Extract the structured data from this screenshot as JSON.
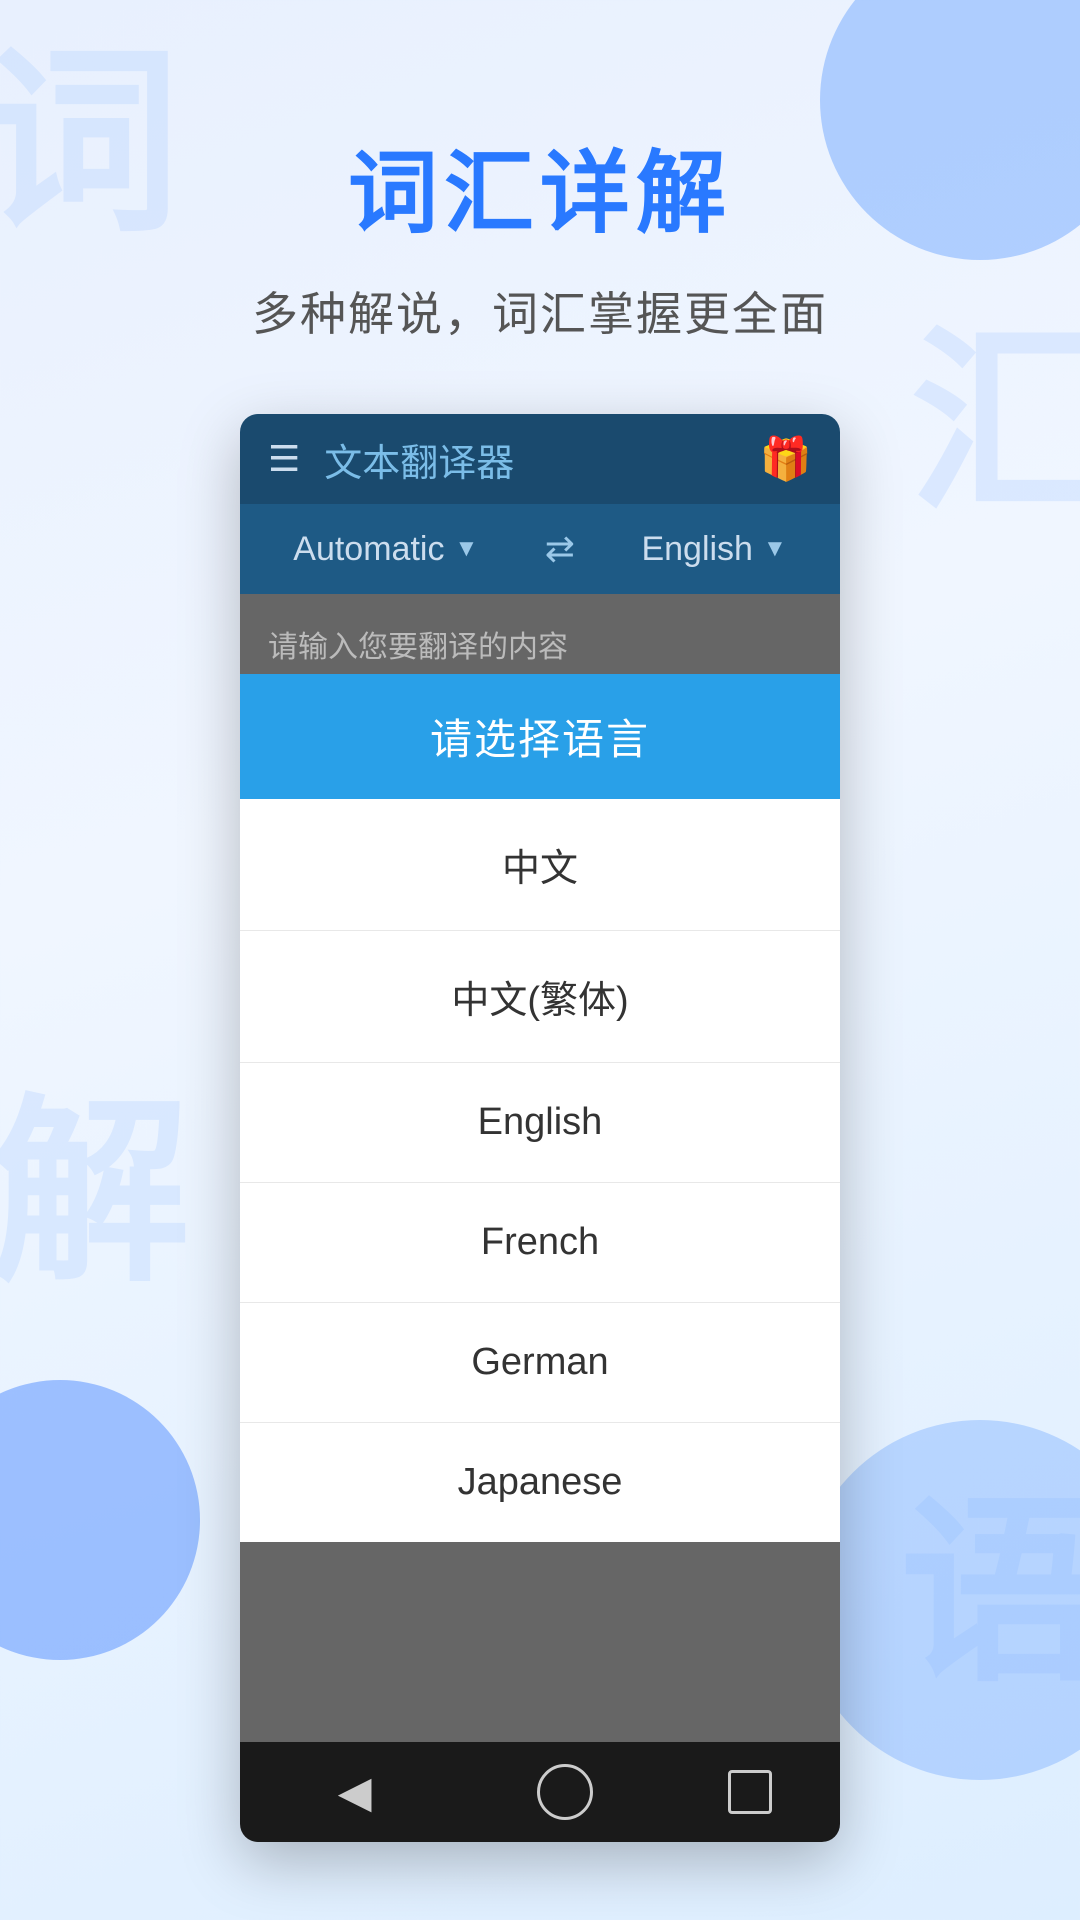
{
  "background": {
    "watermarks": [
      "词",
      "汇",
      "解",
      "语"
    ]
  },
  "header": {
    "title": "词汇详解",
    "subtitle": "多种解说，词汇掌握更全面"
  },
  "app": {
    "toolbar": {
      "menu_icon": "☰",
      "title": "文本翻译器",
      "gift_icon": "🎁"
    },
    "lang_bar": {
      "from_lang": "Automatic",
      "swap_icon": "⇄",
      "to_lang": "English"
    },
    "input_placeholder": "请输入您要翻译的内容"
  },
  "dialog": {
    "header": "请选择语言",
    "languages": [
      {
        "id": "chinese-simplified",
        "label": "中文"
      },
      {
        "id": "chinese-traditional",
        "label": "中文(繁体)"
      },
      {
        "id": "english",
        "label": "English"
      },
      {
        "id": "french",
        "label": "French"
      },
      {
        "id": "german",
        "label": "German"
      },
      {
        "id": "japanese",
        "label": "Japanese"
      }
    ]
  },
  "navbar": {
    "back_label": "◀",
    "home_label": "⬤",
    "recent_label": "■"
  }
}
